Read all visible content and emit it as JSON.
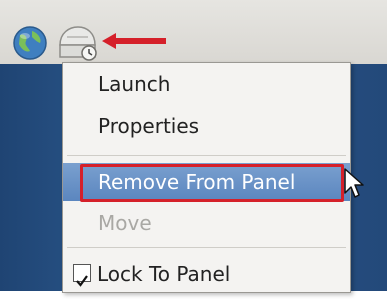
{
  "panel": {
    "icons": [
      "globe-icon",
      "launcher-icon"
    ],
    "callout_color": "#d5202a"
  },
  "context_menu": {
    "items": [
      {
        "label": "Launch",
        "enabled": true
      },
      {
        "label": "Properties",
        "enabled": true
      },
      {
        "label": "Remove From Panel",
        "enabled": true,
        "highlighted": true
      },
      {
        "label": "Move",
        "enabled": false
      },
      {
        "label": "Lock To Panel",
        "enabled": true,
        "checked": true
      }
    ],
    "highlight_color": "#5b86bf"
  }
}
